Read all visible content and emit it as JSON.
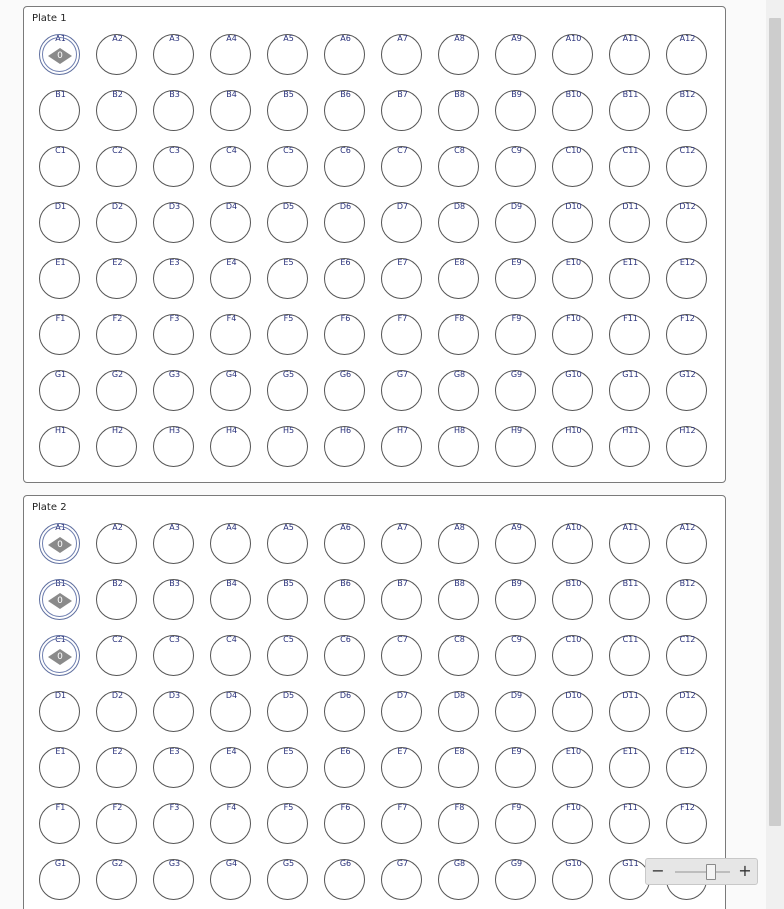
{
  "plates": [
    {
      "title": "Plate 1",
      "rows": [
        "A",
        "B",
        "C",
        "D",
        "E",
        "F",
        "G",
        "H"
      ],
      "columns": [
        "1",
        "2",
        "3",
        "4",
        "5",
        "6",
        "7",
        "8",
        "9",
        "10",
        "11",
        "12"
      ],
      "samples": [
        {
          "well": "A1",
          "value": "0"
        }
      ]
    },
    {
      "title": "Plate 2",
      "rows": [
        "A",
        "B",
        "C",
        "D",
        "E",
        "F",
        "G"
      ],
      "columns": [
        "1",
        "2",
        "3",
        "4",
        "5",
        "6",
        "7",
        "8",
        "9",
        "10",
        "11",
        "12"
      ],
      "samples": [
        {
          "well": "A1",
          "value": "0"
        },
        {
          "well": "B1",
          "value": "0"
        },
        {
          "well": "C1",
          "value": "0"
        }
      ]
    }
  ],
  "zoom": {
    "minus_label": "−",
    "plus_label": "+",
    "level": 0.5
  },
  "colors": {
    "marker_fill": "#8a8a8a",
    "well_border": "#555555",
    "label_text": "#28307a"
  }
}
